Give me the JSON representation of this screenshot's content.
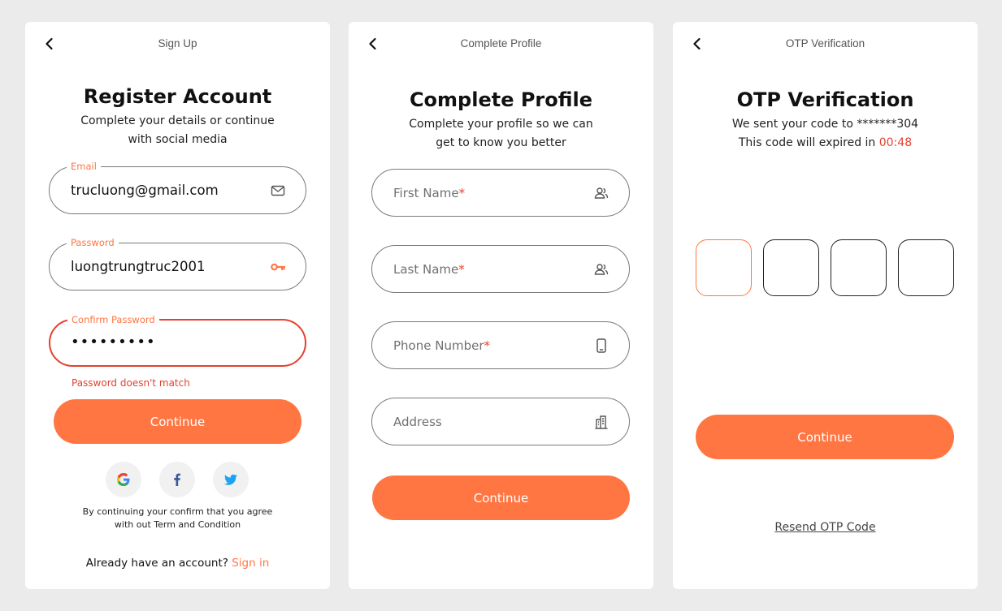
{
  "colors": {
    "accent": "#ff7643",
    "error": "#e4412f",
    "background": "#ebebeb"
  },
  "signup": {
    "bar_title": "Sign Up",
    "heading": "Register Account",
    "subtitle_line1": "Complete your details or continue",
    "subtitle_line2": "with social media",
    "email": {
      "label": "Email",
      "value": "trucluong@gmail.com",
      "icon": "mail-icon"
    },
    "password": {
      "label": "Password",
      "value": "luongtrungtruc2001",
      "icon": "key-icon"
    },
    "confirm_password": {
      "label": "Confirm Password",
      "value": "•••••••••",
      "error": "Password doesn't match"
    },
    "continue_label": "Continue",
    "social": [
      "google-icon",
      "facebook-icon",
      "twitter-icon"
    ],
    "terms_line1": "By continuing your confirm that you agree",
    "terms_line2": "with out Term and Condition",
    "already_text": "Already have an account?",
    "sign_in_label": "Sign in"
  },
  "profile": {
    "bar_title": "Complete Profile",
    "heading": "Complete Profile",
    "subtitle_line1": "Complete your profile so we can",
    "subtitle_line2": "get to know you better",
    "first_name": {
      "placeholder": "First Name",
      "required": "*",
      "icon": "user-icon"
    },
    "last_name": {
      "placeholder": "Last Name",
      "required": "*",
      "icon": "user-icon"
    },
    "phone": {
      "placeholder": "Phone Number",
      "required": "*",
      "icon": "phone-icon"
    },
    "address": {
      "placeholder": "Address",
      "icon": "building-icon"
    },
    "continue_label": "Continue"
  },
  "otp": {
    "bar_title": "OTP Verification",
    "heading": "OTP Verification",
    "sent_text": "We sent your code to *******304",
    "expire_text": "This code will expired in",
    "timer": "00:48",
    "digits": 4,
    "continue_label": "Continue",
    "resend_label": "Resend OTP Code"
  }
}
